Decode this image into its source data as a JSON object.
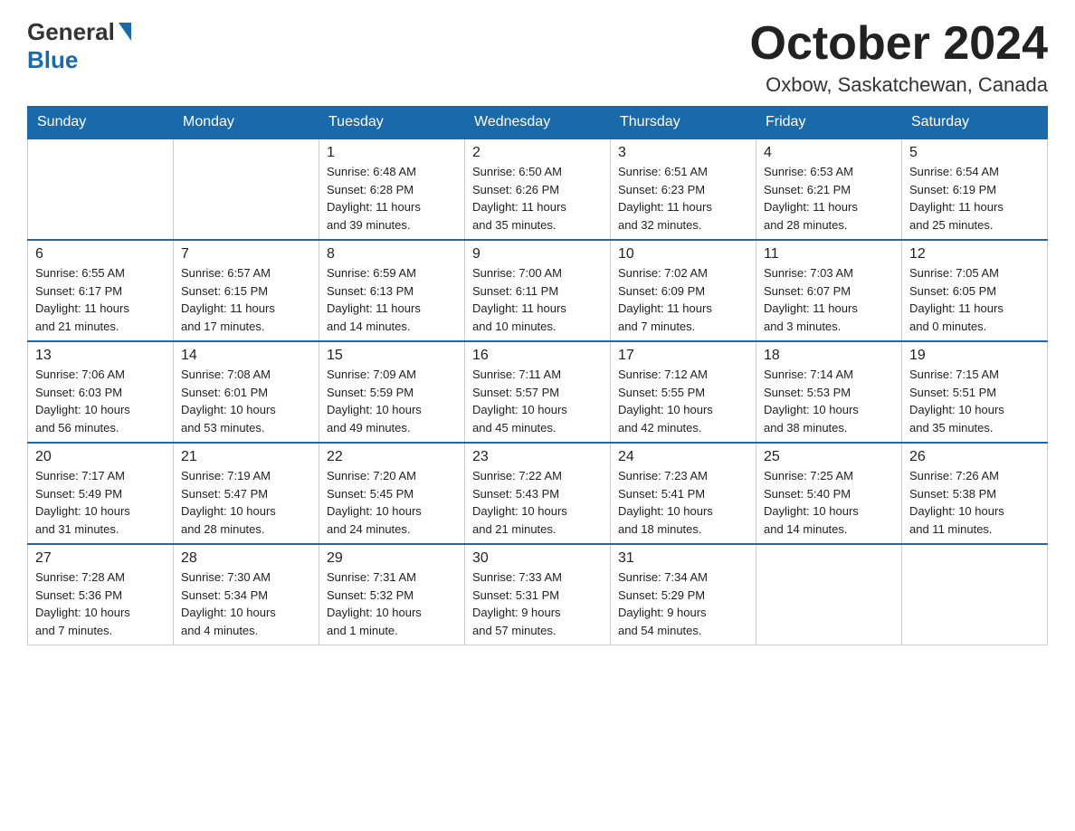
{
  "header": {
    "month_title": "October 2024",
    "location": "Oxbow, Saskatchewan, Canada",
    "logo_general": "General",
    "logo_blue": "Blue",
    "logo_triangle": "▼"
  },
  "weekdays": [
    "Sunday",
    "Monday",
    "Tuesday",
    "Wednesday",
    "Thursday",
    "Friday",
    "Saturday"
  ],
  "weeks": [
    [
      {
        "day": "",
        "info": ""
      },
      {
        "day": "",
        "info": ""
      },
      {
        "day": "1",
        "info": "Sunrise: 6:48 AM\nSunset: 6:28 PM\nDaylight: 11 hours\nand 39 minutes."
      },
      {
        "day": "2",
        "info": "Sunrise: 6:50 AM\nSunset: 6:26 PM\nDaylight: 11 hours\nand 35 minutes."
      },
      {
        "day": "3",
        "info": "Sunrise: 6:51 AM\nSunset: 6:23 PM\nDaylight: 11 hours\nand 32 minutes."
      },
      {
        "day": "4",
        "info": "Sunrise: 6:53 AM\nSunset: 6:21 PM\nDaylight: 11 hours\nand 28 minutes."
      },
      {
        "day": "5",
        "info": "Sunrise: 6:54 AM\nSunset: 6:19 PM\nDaylight: 11 hours\nand 25 minutes."
      }
    ],
    [
      {
        "day": "6",
        "info": "Sunrise: 6:55 AM\nSunset: 6:17 PM\nDaylight: 11 hours\nand 21 minutes."
      },
      {
        "day": "7",
        "info": "Sunrise: 6:57 AM\nSunset: 6:15 PM\nDaylight: 11 hours\nand 17 minutes."
      },
      {
        "day": "8",
        "info": "Sunrise: 6:59 AM\nSunset: 6:13 PM\nDaylight: 11 hours\nand 14 minutes."
      },
      {
        "day": "9",
        "info": "Sunrise: 7:00 AM\nSunset: 6:11 PM\nDaylight: 11 hours\nand 10 minutes."
      },
      {
        "day": "10",
        "info": "Sunrise: 7:02 AM\nSunset: 6:09 PM\nDaylight: 11 hours\nand 7 minutes."
      },
      {
        "day": "11",
        "info": "Sunrise: 7:03 AM\nSunset: 6:07 PM\nDaylight: 11 hours\nand 3 minutes."
      },
      {
        "day": "12",
        "info": "Sunrise: 7:05 AM\nSunset: 6:05 PM\nDaylight: 11 hours\nand 0 minutes."
      }
    ],
    [
      {
        "day": "13",
        "info": "Sunrise: 7:06 AM\nSunset: 6:03 PM\nDaylight: 10 hours\nand 56 minutes."
      },
      {
        "day": "14",
        "info": "Sunrise: 7:08 AM\nSunset: 6:01 PM\nDaylight: 10 hours\nand 53 minutes."
      },
      {
        "day": "15",
        "info": "Sunrise: 7:09 AM\nSunset: 5:59 PM\nDaylight: 10 hours\nand 49 minutes."
      },
      {
        "day": "16",
        "info": "Sunrise: 7:11 AM\nSunset: 5:57 PM\nDaylight: 10 hours\nand 45 minutes."
      },
      {
        "day": "17",
        "info": "Sunrise: 7:12 AM\nSunset: 5:55 PM\nDaylight: 10 hours\nand 42 minutes."
      },
      {
        "day": "18",
        "info": "Sunrise: 7:14 AM\nSunset: 5:53 PM\nDaylight: 10 hours\nand 38 minutes."
      },
      {
        "day": "19",
        "info": "Sunrise: 7:15 AM\nSunset: 5:51 PM\nDaylight: 10 hours\nand 35 minutes."
      }
    ],
    [
      {
        "day": "20",
        "info": "Sunrise: 7:17 AM\nSunset: 5:49 PM\nDaylight: 10 hours\nand 31 minutes."
      },
      {
        "day": "21",
        "info": "Sunrise: 7:19 AM\nSunset: 5:47 PM\nDaylight: 10 hours\nand 28 minutes."
      },
      {
        "day": "22",
        "info": "Sunrise: 7:20 AM\nSunset: 5:45 PM\nDaylight: 10 hours\nand 24 minutes."
      },
      {
        "day": "23",
        "info": "Sunrise: 7:22 AM\nSunset: 5:43 PM\nDaylight: 10 hours\nand 21 minutes."
      },
      {
        "day": "24",
        "info": "Sunrise: 7:23 AM\nSunset: 5:41 PM\nDaylight: 10 hours\nand 18 minutes."
      },
      {
        "day": "25",
        "info": "Sunrise: 7:25 AM\nSunset: 5:40 PM\nDaylight: 10 hours\nand 14 minutes."
      },
      {
        "day": "26",
        "info": "Sunrise: 7:26 AM\nSunset: 5:38 PM\nDaylight: 10 hours\nand 11 minutes."
      }
    ],
    [
      {
        "day": "27",
        "info": "Sunrise: 7:28 AM\nSunset: 5:36 PM\nDaylight: 10 hours\nand 7 minutes."
      },
      {
        "day": "28",
        "info": "Sunrise: 7:30 AM\nSunset: 5:34 PM\nDaylight: 10 hours\nand 4 minutes."
      },
      {
        "day": "29",
        "info": "Sunrise: 7:31 AM\nSunset: 5:32 PM\nDaylight: 10 hours\nand 1 minute."
      },
      {
        "day": "30",
        "info": "Sunrise: 7:33 AM\nSunset: 5:31 PM\nDaylight: 9 hours\nand 57 minutes."
      },
      {
        "day": "31",
        "info": "Sunrise: 7:34 AM\nSunset: 5:29 PM\nDaylight: 9 hours\nand 54 minutes."
      },
      {
        "day": "",
        "info": ""
      },
      {
        "day": "",
        "info": ""
      }
    ]
  ]
}
